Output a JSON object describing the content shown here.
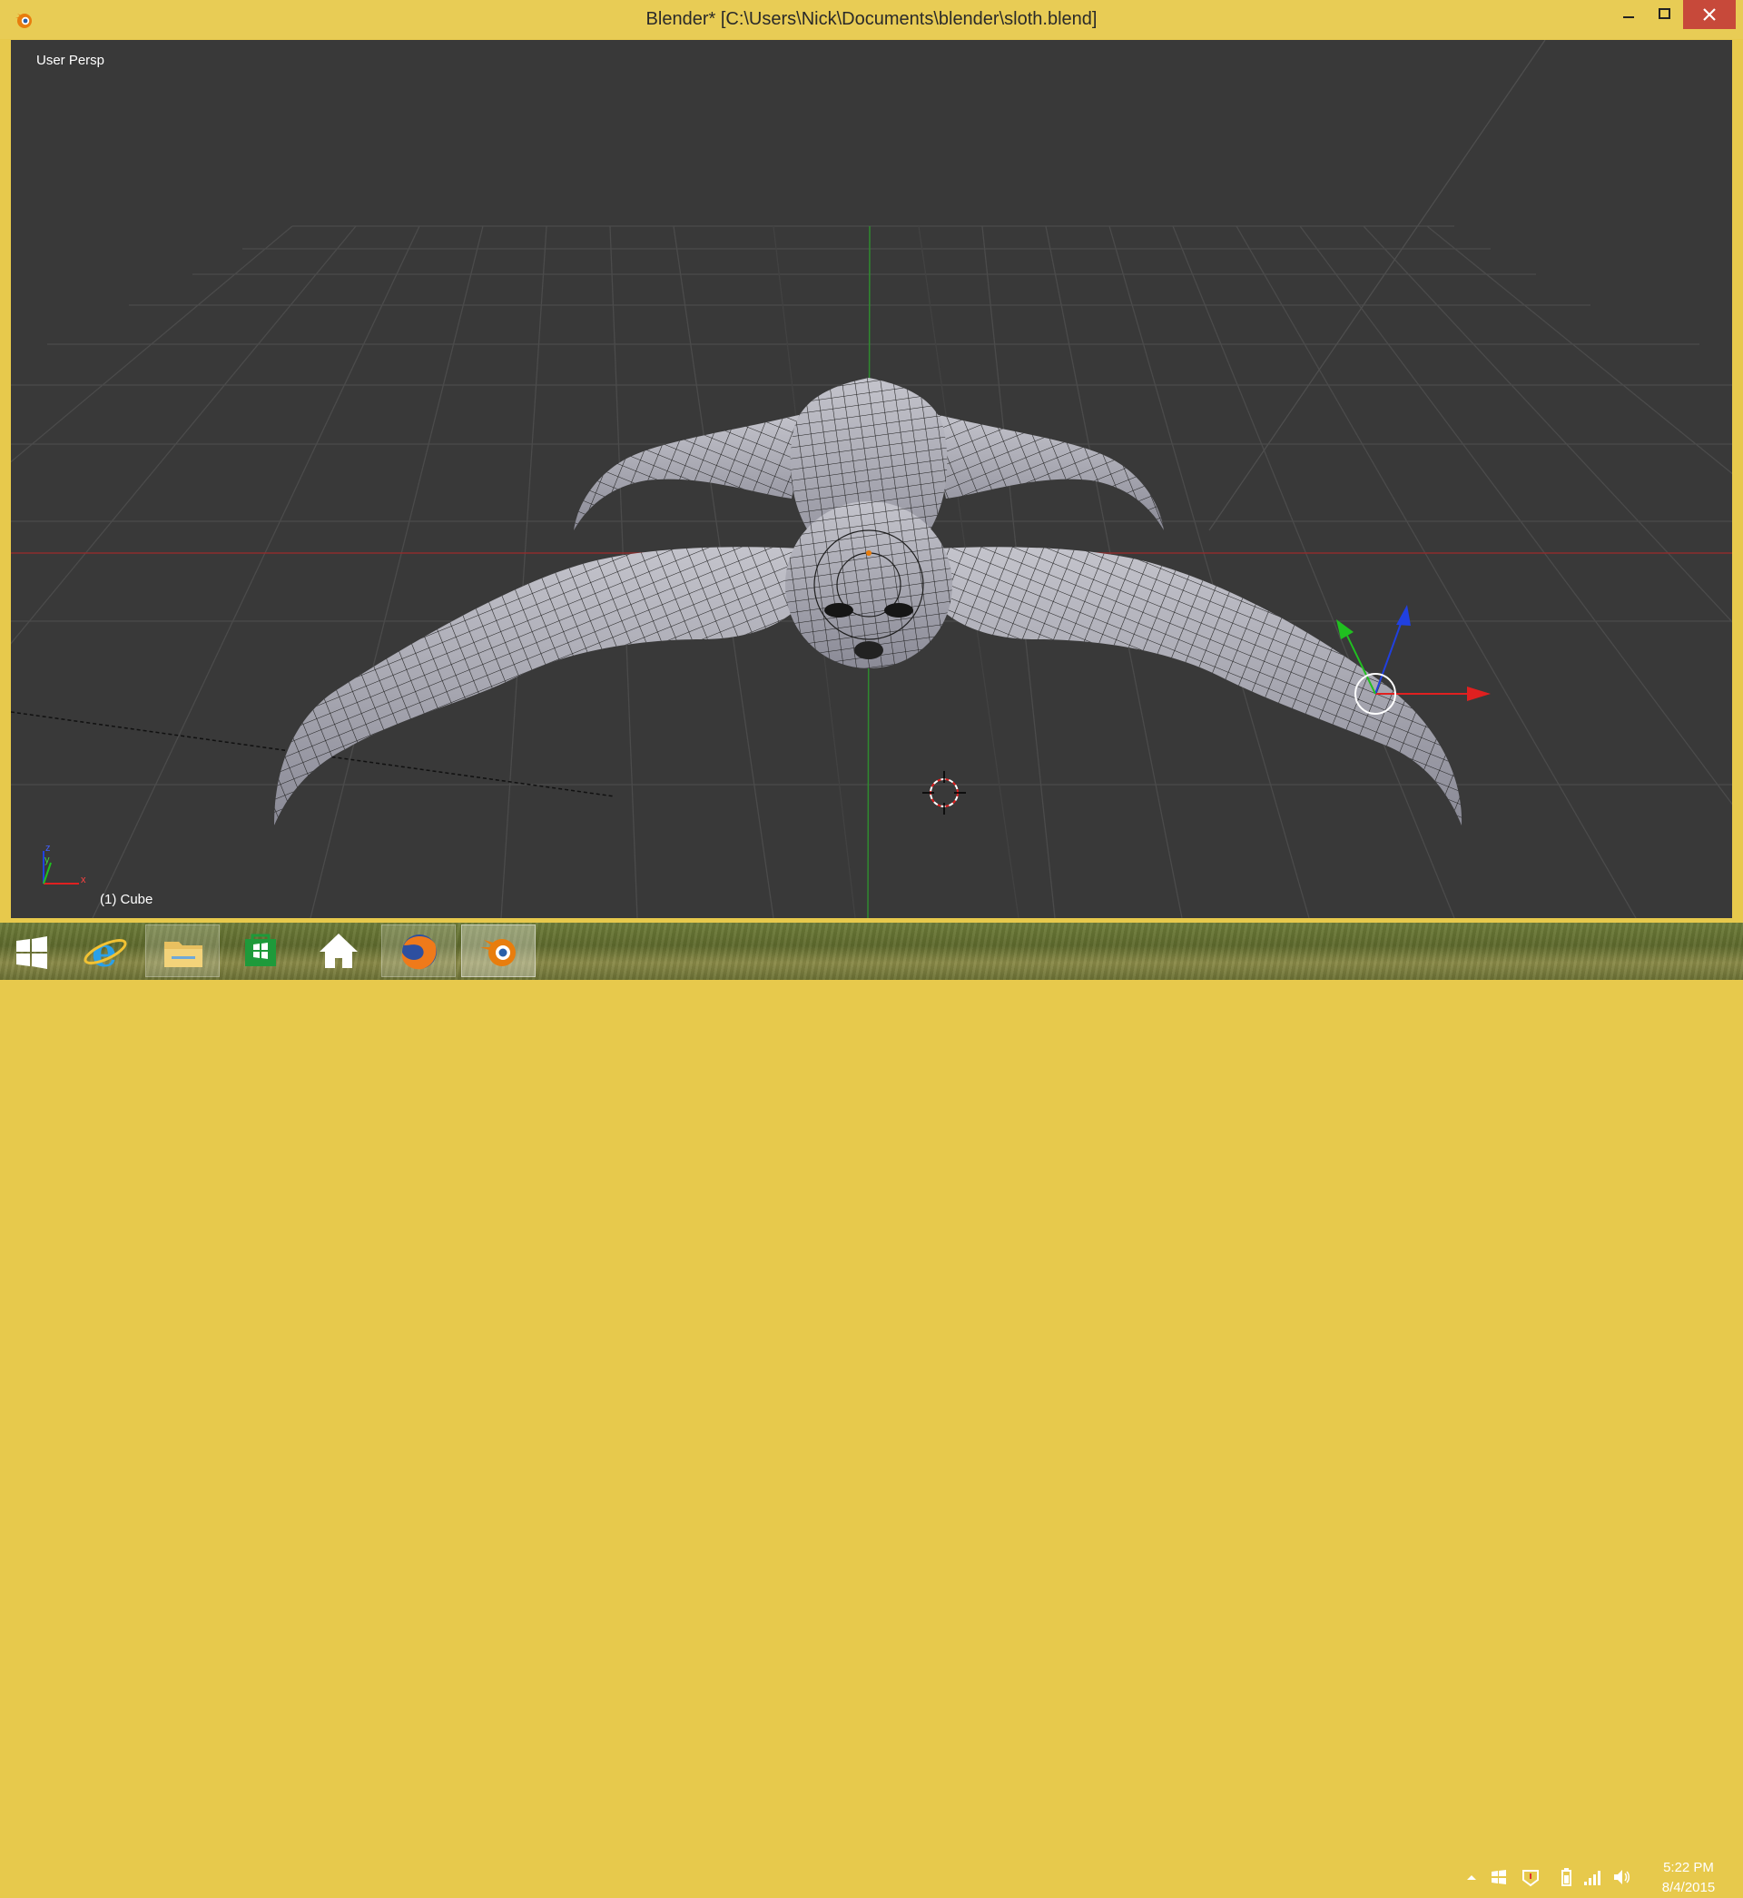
{
  "window": {
    "title": "Blender* [C:\\Users\\Nick\\Documents\\blender\\sloth.blend]",
    "controls": {
      "minimize_icon": "minimize-icon",
      "maximize_icon": "maximize-icon",
      "close_icon": "close-icon"
    }
  },
  "viewport": {
    "view_label": "User Persp",
    "active_object_label": "(1) Cube",
    "colors": {
      "background": "#393939",
      "grid": "#4a4a4a",
      "x_axis": "#8e2e2e",
      "y_axis": "#2f8a2f",
      "mesh_fill": "#a9a9b4",
      "wire": "#1d1d1d"
    },
    "gizmo": {
      "x_color": "#e02020",
      "y_color": "#20c020",
      "z_color": "#2040e0"
    },
    "axis_indicator": {
      "labels": [
        "z",
        "y",
        "x"
      ]
    }
  },
  "taskbar": {
    "items": [
      {
        "name": "start-button",
        "icon": "windows-logo-icon"
      },
      {
        "name": "internet-explorer",
        "icon": "internet-explorer-icon"
      },
      {
        "name": "file-explorer",
        "icon": "folder-icon"
      },
      {
        "name": "store",
        "icon": "store-icon"
      },
      {
        "name": "home",
        "icon": "home-icon"
      },
      {
        "name": "firefox",
        "icon": "firefox-icon"
      },
      {
        "name": "blender",
        "icon": "blender-icon"
      }
    ],
    "tray": {
      "icons": [
        "show-hidden-icons-icon",
        "windows-flag-icon",
        "action-center-icon",
        "battery-icon",
        "network-signal-icon",
        "volume-icon"
      ],
      "time": "5:22 PM",
      "date": "8/4/2015"
    }
  }
}
